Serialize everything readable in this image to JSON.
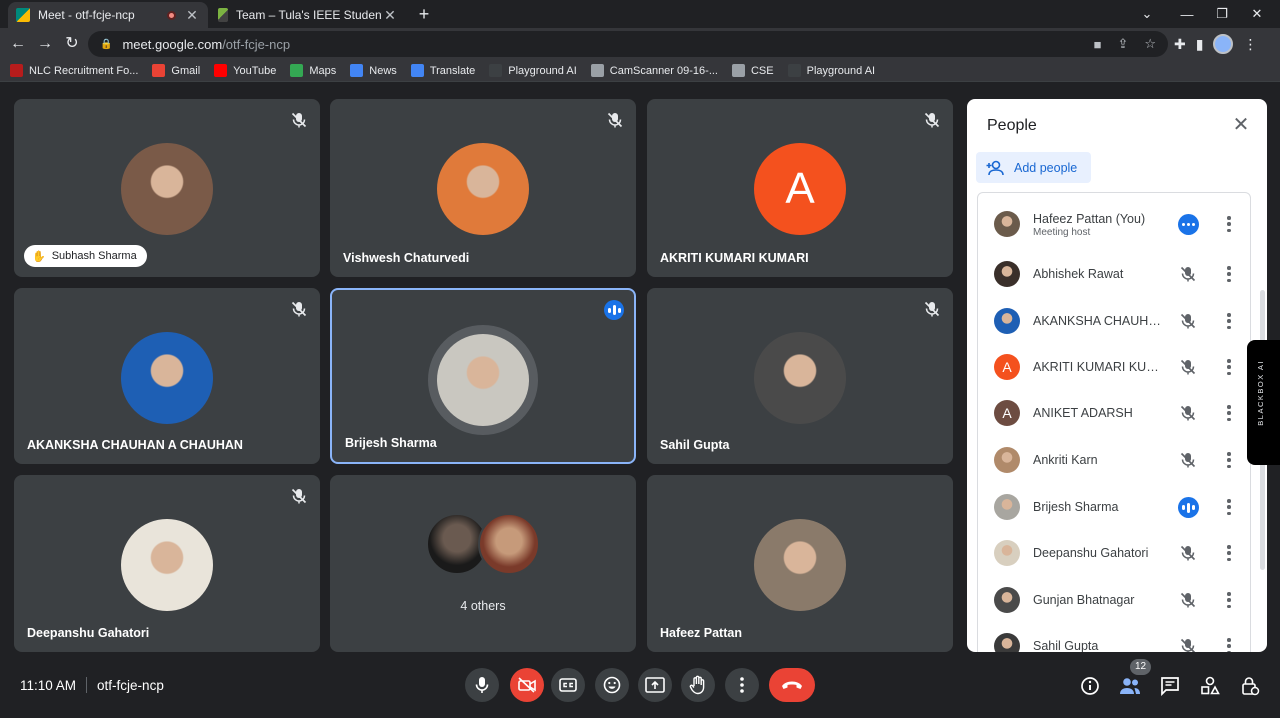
{
  "browser": {
    "tabs": [
      {
        "title": "Meet - otf-fcje-ncp",
        "active": true
      },
      {
        "title": "Team – Tula's IEEE Student Branch",
        "active": false
      }
    ],
    "new_tab": "+",
    "url_host": "meet.google.com",
    "url_path": "/otf-fcje-ncp",
    "bookmarks": [
      {
        "label": "NLC Recruitment Fo...",
        "color": "#b71c1c"
      },
      {
        "label": "Gmail",
        "color": "#ea4335"
      },
      {
        "label": "YouTube",
        "color": "#ff0000"
      },
      {
        "label": "Maps",
        "color": "#34a853"
      },
      {
        "label": "News",
        "color": "#4285f4"
      },
      {
        "label": "Translate",
        "color": "#4285f4"
      },
      {
        "label": "Playground AI",
        "color": "#3c4043"
      },
      {
        "label": "CamScanner 09-16-...",
        "color": "#9aa0a6"
      },
      {
        "label": "CSE",
        "color": "#9aa0a6"
      },
      {
        "label": "Playground AI",
        "color": "#3c4043"
      }
    ]
  },
  "tiles": [
    {
      "name": "Subhash Sharma",
      "avatar_color": "#7a5a48",
      "style": "pill",
      "muted": true
    },
    {
      "name": "Vishwesh Chaturvedi",
      "avatar_color": "#e07a3a",
      "style": "plain",
      "muted": true
    },
    {
      "name": "AKRITI KUMARI KUMARI",
      "avatar_color": "#f4511e",
      "initial": "A",
      "style": "plain",
      "muted": true
    },
    {
      "name": "AKANKSHA CHAUHAN A CHAUHAN",
      "avatar_color": "#1e5fb4",
      "style": "plain",
      "muted": true
    },
    {
      "name": "Brijesh Sharma",
      "avatar_color": "#c9c7c0",
      "style": "plain",
      "speaking": true
    },
    {
      "name": "Sahil Gupta",
      "avatar_color": "#4a4a4a",
      "style": "plain",
      "muted": true
    },
    {
      "name": "Deepanshu Gahatori",
      "avatar_color": "#e9e4da",
      "style": "plain",
      "muted": true
    },
    {
      "name": "4 others",
      "style": "others"
    },
    {
      "name": "Hafeez Pattan",
      "avatar_color": "#8a7a6a",
      "style": "plain",
      "muted": false
    }
  ],
  "panel": {
    "title": "People",
    "add_people": "Add people",
    "participants": [
      {
        "name": "Hafeez Pattan (You)",
        "sub": "Meeting host",
        "avatar_color": "#6b5b4b",
        "state": "more"
      },
      {
        "name": "Abhishek Rawat",
        "avatar_color": "#3a2f2a",
        "state": "muted"
      },
      {
        "name": "AKANKSHA CHAUHAN A CHAUHAN",
        "avatar_color": "#1e5fb4",
        "state": "muted"
      },
      {
        "name": "AKRITI KUMARI KUMARI",
        "avatar_color": "#f4511e",
        "initial": "A",
        "state": "muted"
      },
      {
        "name": "ANIKET ADARSH",
        "avatar_color": "#6d4c41",
        "initial": "A",
        "state": "muted"
      },
      {
        "name": "Ankriti Karn",
        "avatar_color": "#b08a6a",
        "state": "muted"
      },
      {
        "name": "Brijesh Sharma",
        "avatar_color": "#a8a6a0",
        "state": "speaking"
      },
      {
        "name": "Deepanshu Gahatori",
        "avatar_color": "#d8cfbf",
        "state": "muted"
      },
      {
        "name": "Gunjan Bhatnagar",
        "avatar_color": "#4a4a4a",
        "state": "muted"
      },
      {
        "name": "Sahil Gupta",
        "avatar_color": "#3a3a3a",
        "state": "muted"
      }
    ]
  },
  "side_tab": "BLACKBOX AI",
  "bottom": {
    "time": "11:10 AM",
    "meeting_code": "otf-fcje-ncp",
    "people_count": "12"
  }
}
